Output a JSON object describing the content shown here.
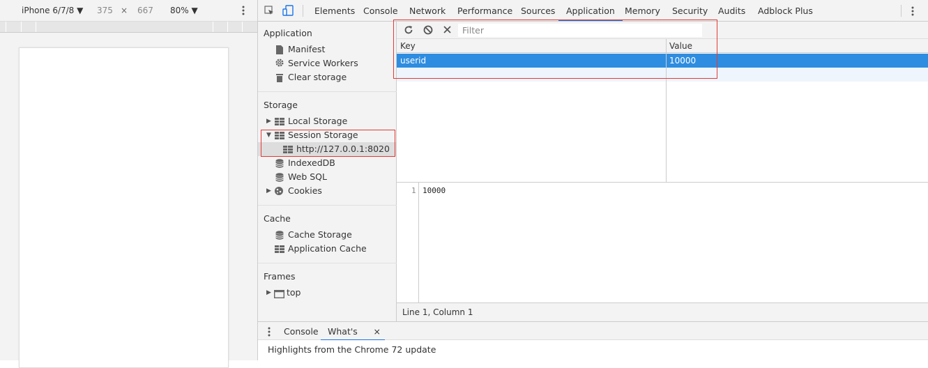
{
  "device_toolbar": {
    "device": "iPhone 6/7/8 ▼",
    "width": "375",
    "times": "×",
    "height": "667",
    "zoom": "80% ▼",
    "menu_icon": "more-vertical-icon"
  },
  "devtools_tabs": {
    "icons": [
      "inspect-element-icon",
      "device-toggle-icon"
    ],
    "tabs": [
      "Elements",
      "Console",
      "Network",
      "Performance",
      "Sources",
      "Application",
      "Memory",
      "Security",
      "Audits",
      "Adblock Plus"
    ],
    "active": "Application"
  },
  "sidebar": {
    "application_header": "Application",
    "application_items": [
      "Manifest",
      "Service Workers",
      "Clear storage"
    ],
    "storage_header": "Storage",
    "storage_items": {
      "local_storage": "Local Storage",
      "session_storage": "Session Storage",
      "session_origin": "http://127.0.0.1:8020",
      "indexeddb": "IndexedDB",
      "web_sql": "Web SQL",
      "cookies": "Cookies"
    },
    "cache_header": "Cache",
    "cache_items": [
      "Cache Storage",
      "Application Cache"
    ],
    "frames_header": "Frames",
    "frames_items": [
      "top"
    ]
  },
  "main": {
    "filter_placeholder": "Filter",
    "columns": [
      "Key",
      "Value"
    ],
    "rows": [
      {
        "key": "userid",
        "value": "10000"
      }
    ],
    "editor": {
      "line_number": "1",
      "content": "10000"
    },
    "status": "Line 1, Column 1"
  },
  "drawer": {
    "tabs": [
      "Console",
      "What's New"
    ],
    "active": "What's New",
    "close_glyph": "×",
    "content": "Highlights from the Chrome 72 update"
  },
  "colors": {
    "accent": "#1a73e8",
    "selected_row": "#2e8de0",
    "highlight_box": "#e53935"
  }
}
